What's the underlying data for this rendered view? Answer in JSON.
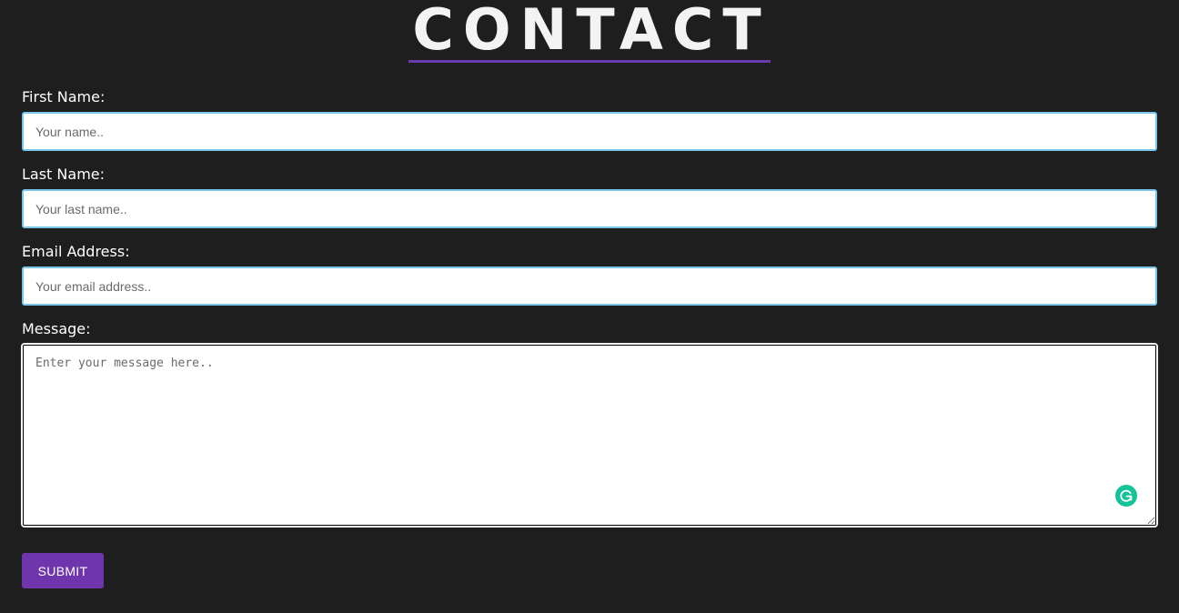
{
  "header": {
    "title": "CONTACT"
  },
  "form": {
    "first_name": {
      "label": "First Name:",
      "placeholder": "Your name..",
      "value": ""
    },
    "last_name": {
      "label": "Last Name:",
      "placeholder": "Your last name..",
      "value": ""
    },
    "email": {
      "label": "Email Address:",
      "placeholder": "Your email address..",
      "value": ""
    },
    "message": {
      "label": "Message:",
      "placeholder": "Enter your message here..",
      "value": ""
    },
    "submit_label": "SUBMIT"
  },
  "icons": {
    "grammarly": "grammarly-icon"
  },
  "colors": {
    "background": "#1e1e1e",
    "accent": "#6f35ad",
    "input_focus_border": "#7cc4ea",
    "grammarly": "#15c39a"
  }
}
